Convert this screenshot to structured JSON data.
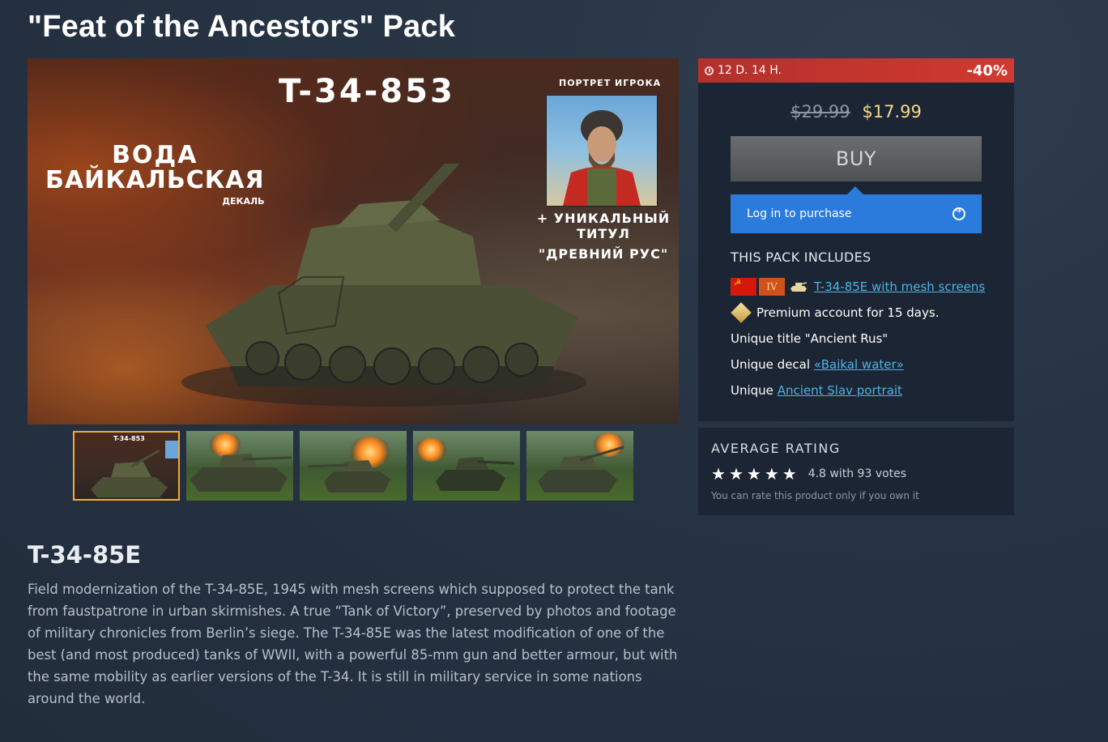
{
  "page": {
    "title": "\"Feat of the Ancestors\" Pack"
  },
  "hero": {
    "vehicle_label": "T-34-853",
    "decal_line1": "ВОДА",
    "decal_line2": "БАЙКАЛЬСКАЯ",
    "decal_line3": "ДЕКАЛЬ",
    "portrait_label": "ПОРТРЕТ ИГРОКА",
    "title_line1": "+ УНИКАЛЬНЫЙ ТИТУЛ",
    "title_line2": "\"ДРЕВНИЙ РУС\""
  },
  "thumbnails": {
    "count": 5,
    "active_index": 0,
    "first_label": "T-34-853"
  },
  "offer": {
    "timer": "12 D. 14 H.",
    "discount": "-40%",
    "old_price": "$29.99",
    "new_price": "$17.99",
    "buy_label": "BUY",
    "login_label": "Log in to purchase",
    "includes_title": "THIS PACK INCLUDES",
    "items": [
      {
        "prefix": "",
        "link": "T-34-85E with mesh screens",
        "rank": "IV",
        "icon": "tank-icon"
      },
      {
        "prefix": "Premium account for 15 days.",
        "link": "",
        "icon": "premium-icon"
      },
      {
        "prefix": "Unique title \"Ancient Rus\"",
        "link": ""
      },
      {
        "prefix": "Unique decal ",
        "link": "«Baikal water»"
      },
      {
        "prefix": "Unique ",
        "link": "Ancient Slav portrait"
      }
    ]
  },
  "rating": {
    "title": "AVERAGE RATING",
    "score_text": "4.8 with 93 votes",
    "stars": 4.8,
    "note": "You can rate this product only if you own it"
  },
  "description": {
    "title": "T-34-85E",
    "text": "Field modernization of the T-34-85E, 1945 with mesh screens which supposed to protect the tank from faustpatrone in urban skirmishes. A true “Tank of Victory”, preserved by photos and footage of military chronicles from Berlin’s siege. The T-34-85E was the latest modification of one of the best (and most produced) tanks of WWII, with a powerful 85-mm gun and better armour, but with the same mobility as earlier versions of the T-34. It is still in military service in some nations around the world."
  },
  "colors": {
    "accent_blue": "#2b7bdc",
    "timer_red": "#d0392f",
    "price_gold": "#f5d98a",
    "link": "#4bb4e6",
    "active_thumb_border": "#f2a93b"
  }
}
